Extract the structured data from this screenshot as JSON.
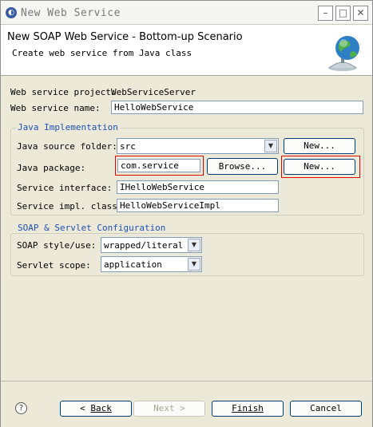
{
  "window": {
    "title": "New Web Service"
  },
  "header": {
    "title": "New SOAP Web Service - Bottom-up Scenario",
    "description": "Create web service from Java class"
  },
  "form": {
    "project_label": "Web service project:",
    "project_value": "WebServiceServer",
    "name_label": "Web service name:",
    "name_value": "HelloWebService"
  },
  "java_impl": {
    "group_title": "Java Implementation",
    "source_folder_label": "Java source folder:",
    "source_folder_value": "src",
    "source_new_button": "New...",
    "package_label": "Java package:",
    "package_value": "com.service",
    "browse_button": "Browse...",
    "package_new_button": "New...",
    "interface_label": "Service interface:",
    "interface_value": "IHelloWebService",
    "impl_label": "Service impl. class:",
    "impl_value": "HelloWebServiceImpl"
  },
  "soap_config": {
    "group_title": "SOAP & Servlet Configuration",
    "style_label": "SOAP style/use:",
    "style_value": "wrapped/literal",
    "scope_label": "Servlet scope:",
    "scope_value": "application"
  },
  "footer": {
    "help": "?",
    "back_arrow": "<",
    "back_label": "Back",
    "next_label": "Next",
    "next_arrow": ">",
    "finish_label": "Finish",
    "cancel_label": "Cancel"
  },
  "title_buttons": {
    "minimize": "–",
    "maximize": "□",
    "close": "✕"
  },
  "colors": {
    "dialog_bg": "#ece9d8",
    "group_title": "#1f4fb5",
    "highlight_box": "#e00000"
  }
}
